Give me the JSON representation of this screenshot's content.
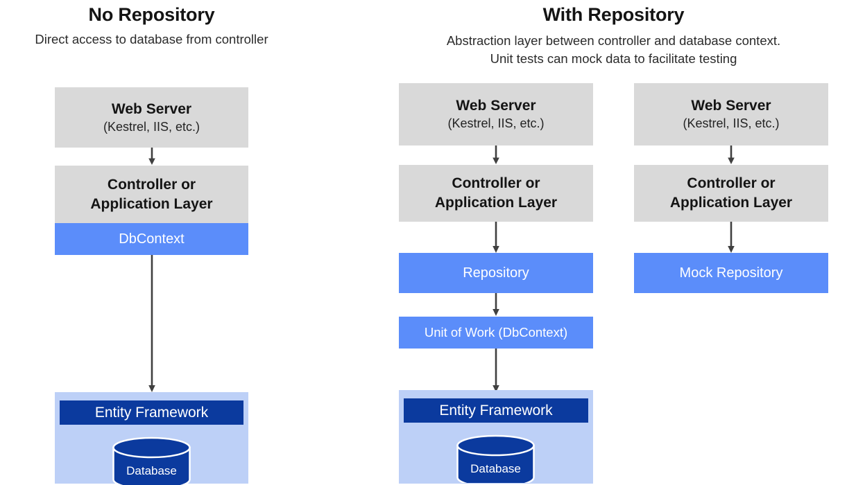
{
  "sections": [
    {
      "title": "No Repository",
      "subtitle_lines": [
        "Direct access to database from controller"
      ]
    },
    {
      "title": "With Repository",
      "subtitle_lines": [
        "Abstraction layer between controller and database context.",
        "Unit tests can mock data to facilitate testing"
      ]
    }
  ],
  "colors": {
    "grey_box": "#d9d9d9",
    "blue_box": "#5b8dfa",
    "light_blue_panel": "#bdd0f7",
    "dark_blue_bar": "#0b3a9e",
    "arrow": "#404040",
    "text_dark": "#141414",
    "text_white": "#ffffff"
  },
  "columns": {
    "no_repository": {
      "web_server": {
        "title": "Web Server",
        "subtitle": "(Kestrel, IIS, etc.)"
      },
      "controller": {
        "line1": "Controller or",
        "line2": "Application Layer"
      },
      "dbcontext": {
        "label": "DbContext"
      },
      "data_panel": {
        "entity_framework": "Entity Framework",
        "database": "Database"
      }
    },
    "with_repository": {
      "web_server": {
        "title": "Web Server",
        "subtitle": "(Kestrel, IIS, etc.)"
      },
      "controller": {
        "line1": "Controller or",
        "line2": "Application Layer"
      },
      "repository": {
        "label": "Repository"
      },
      "unit_of_work": {
        "label": "Unit of Work (DbContext)"
      },
      "data_panel": {
        "entity_framework": "Entity Framework",
        "database": "Database"
      }
    },
    "with_mock_repository": {
      "web_server": {
        "title": "Web Server",
        "subtitle": "(Kestrel, IIS, etc.)"
      },
      "controller": {
        "line1": "Controller or",
        "line2": "Application Layer"
      },
      "mock_repository": {
        "label": "Mock Repository"
      }
    }
  }
}
